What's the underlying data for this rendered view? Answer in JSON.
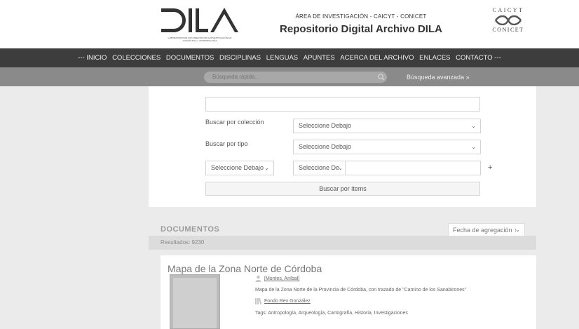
{
  "header": {
    "logo_text": "DILA",
    "logo_subtitle": "LABORATORIO DE DOCUMENTACIÓN E INVESTIGACIÓN EN LINGÜÍSTICA Y ANTROPOLOGÍA",
    "area": "ÁREA DE INVESTIGACIÓN - CAICYT - CONICET",
    "title": "Repositorio Digital Archivo DILA",
    "partner_top": "CAICYT",
    "partner_bottom": "CONICET"
  },
  "nav": {
    "items": [
      "--- INICIO",
      "COLECCIONES",
      "DOCUMENTOS",
      "DISCIPLINAS",
      "LENGUAS",
      "APUNTES",
      "ACERCA DEL ARCHIVO",
      "ENLACES",
      "CONTACTO ---"
    ]
  },
  "search": {
    "placeholder": "Búsqueda rápida...",
    "advanced": "Búsqueda avanzada »"
  },
  "filters": {
    "keyword_value": "",
    "collection_label": "Buscar por colección",
    "collection_value": "Seleccione Debajo",
    "type_label": "Buscar por tipo",
    "type_value": "Seleccione Debajo",
    "field1_value": "Seleccione Debajo",
    "field2_value": "Seleccione De",
    "field3_value": "",
    "plus": "+",
    "submit": "Buscar por items"
  },
  "documents": {
    "title": "DOCUMENTOS",
    "sort": "Fecha de agregación ↑",
    "results": "Resultados: 9230"
  },
  "item": {
    "title": "Mapa de la Zona Norte de Córdoba",
    "author": "[Montes, Aníbal]",
    "description": "Mapa de la Zona Norte de la Provincia de Córdoba, con trazado de \"Camino de los Sanabirones\"",
    "collection": "Fondo Rex González",
    "tags": "Tags: Antropología, Arqueología, Cartografía, Historia, Investigaciones"
  }
}
